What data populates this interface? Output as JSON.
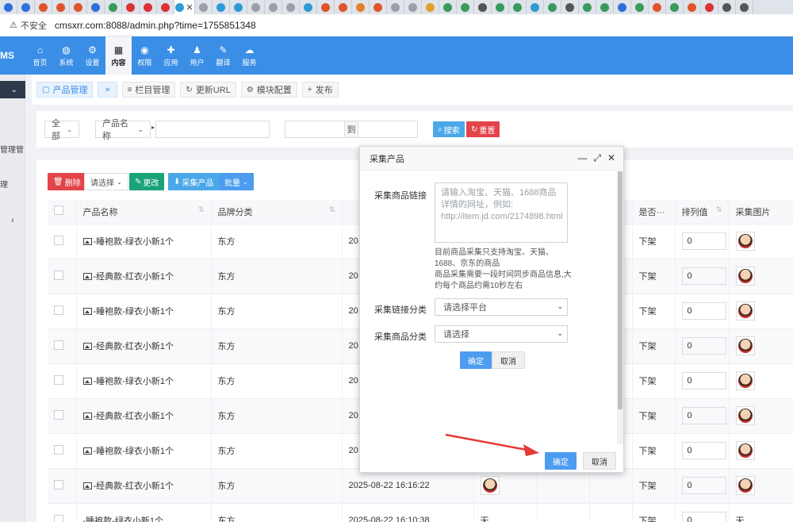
{
  "browser": {
    "tab_colors": [
      "#2f6fd6",
      "#2f6fd6",
      "#e0542c",
      "#e0542c",
      "#e0542c",
      "#2f6fd6",
      "#3a9a5c",
      "#d93333",
      "#d93333",
      "#d93333",
      "#2f9ad6",
      "#9aa0a8",
      "#2f9ad6",
      "#2f9ad6",
      "#9aa0a8",
      "#9aa0a8",
      "#9aa0a8",
      "#2f9ad6",
      "#e0542c",
      "#e0542c",
      "#e0802c",
      "#e0542c",
      "#9aa0a8",
      "#9aa0a8",
      "#e0a02c",
      "#3a9a5c",
      "#3a9a5c",
      "#555",
      "#3a9a5c",
      "#3a9a5c",
      "#2f9ad6",
      "#3a9a5c",
      "#555",
      "#3a9a5c",
      "#3a9a5c",
      "#2f6fd6",
      "#3a9a5c",
      "#e0542c",
      "#3a9a5c",
      "#e0542c",
      "#d93333",
      "#555",
      "#555"
    ],
    "insecure_label": "不安全",
    "url": "cmsxrr.com:8088/admin.php?time=1755851348"
  },
  "topnav": {
    "logo": "MS",
    "items": [
      {
        "label": "首页",
        "icon": "home-icon",
        "glyph": "⌂"
      },
      {
        "label": "系统",
        "icon": "globe-icon",
        "glyph": "◍"
      },
      {
        "label": "设置",
        "icon": "gears-icon",
        "glyph": "⚙"
      },
      {
        "label": "内容",
        "icon": "grid-icon",
        "glyph": "▦"
      },
      {
        "label": "权限",
        "icon": "user-circle-icon",
        "glyph": "◉"
      },
      {
        "label": "应用",
        "icon": "puzzle-icon",
        "glyph": "✚"
      },
      {
        "label": "用户",
        "icon": "user-icon",
        "glyph": "♟"
      },
      {
        "label": "翻译",
        "icon": "translate-icon",
        "glyph": "✎"
      },
      {
        "label": "服务",
        "icon": "cloud-icon",
        "glyph": "☁"
      }
    ],
    "active_index": 3
  },
  "sidebar": {
    "text1": "管理管",
    "text2": "理"
  },
  "tabrow": {
    "product_mgmt": "产品管理",
    "column_mgmt": "栏目管理",
    "update_url": "更新URL",
    "module_config": "模块配置",
    "publish": "发布"
  },
  "search": {
    "scope": "全部",
    "field": "产品名称",
    "to": "到",
    "search_btn": "搜索",
    "reset_btn": "重置"
  },
  "actions": {
    "delete": "删除",
    "select": "请选择",
    "change": "更改",
    "collect": "采集产品",
    "batch": "批量"
  },
  "table": {
    "headers": {
      "name": "产品名称",
      "brand": "品牌分类",
      "date": "",
      "status": "是否···",
      "sort": "排列值",
      "image": "采集图片"
    },
    "rows": [
      {
        "name": "-睡袍款-绿衣小新1个",
        "brand": "东方",
        "date": "20",
        "status": "下架",
        "sort": "0",
        "has_image": true,
        "img_text": ""
      },
      {
        "name": "-经典款-红衣小新1个",
        "brand": "东方",
        "date": "20",
        "status": "下架",
        "sort": "0",
        "has_image": true,
        "img_text": ""
      },
      {
        "name": "-睡袍款-绿衣小新1个",
        "brand": "东方",
        "date": "20",
        "status": "下架",
        "sort": "0",
        "has_image": true,
        "img_text": ""
      },
      {
        "name": "-经典款-红衣小新1个",
        "brand": "东方",
        "date": "20",
        "status": "下架",
        "sort": "0",
        "has_image": true,
        "img_text": ""
      },
      {
        "name": "-睡袍款-绿衣小新1个",
        "brand": "东方",
        "date": "20",
        "status": "下架",
        "sort": "0",
        "has_image": true,
        "img_text": ""
      },
      {
        "name": "-经典款-红衣小新1个",
        "brand": "东方",
        "date": "20",
        "status": "下架",
        "sort": "0",
        "has_image": true,
        "img_text": ""
      },
      {
        "name": "-睡袍款-绿衣小新1个",
        "brand": "东方",
        "date": "20",
        "status": "下架",
        "sort": "0",
        "has_image": true,
        "img_text": ""
      },
      {
        "name": "-经典款-红衣小新1个",
        "brand": "东方",
        "date": "2025-08-22 16:16:22",
        "status": "下架",
        "sort": "0",
        "has_image": true,
        "img_text": ""
      },
      {
        "name": "-睡袍款-绿衣小新1个",
        "brand": "东方",
        "date": "2025-08-22 16:10:38",
        "status": "下架",
        "sort": "0",
        "has_image": false,
        "img_text": "无",
        "mid_text": "无"
      }
    ]
  },
  "dialog": {
    "title": "采集产品",
    "link_label": "采集商品链接",
    "link_placeholder": "请输入淘宝、天猫、1688商品详情的网址，例如:\nhttp://item.jd.com/2174898.html",
    "help1": "目前商品采集只支持淘宝、天猫、1688、京东的商品",
    "help2": "商品采集需要一段时间同步商品信息,大约每个商品约需10秒左右",
    "platform_label": "采集链接分类",
    "platform_value": "请选择平台",
    "category_label": "采集商品分类",
    "category_value": "请选择",
    "inner_ok": "确定",
    "inner_cancel": "取消",
    "footer_ok": "确定",
    "footer_cancel": "取消"
  },
  "colors": {
    "nav_blue": "#3a8ee6",
    "delete_red": "#e2444a",
    "change_green": "#1aa37a",
    "collect_blue": "#4aa8e8",
    "batch_blue": "#4c9cf0",
    "arrow_red": "#e53935"
  }
}
